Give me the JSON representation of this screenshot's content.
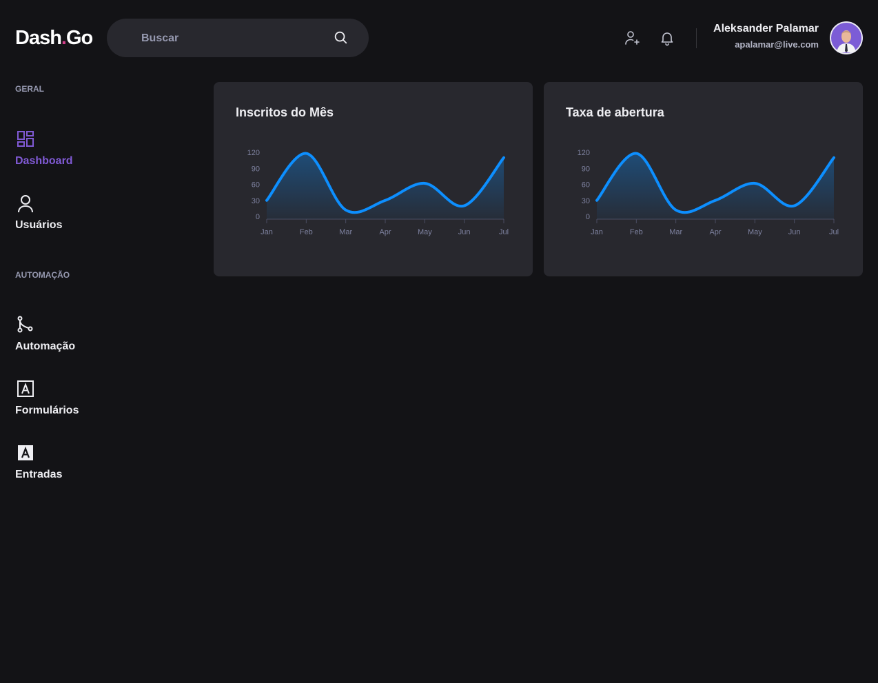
{
  "header": {
    "logo": {
      "text": "Dash",
      "dot": ".",
      "suffix": "Go"
    },
    "search": {
      "placeholder": "Buscar",
      "icon": "search-icon"
    },
    "icons": [
      "user-add-icon",
      "bell-icon"
    ],
    "user": {
      "name": "Aleksander Palamar",
      "email": "apalamar@live.com"
    }
  },
  "sidebar": {
    "sections": [
      {
        "title": "GERAL",
        "items": [
          {
            "label": "Dashboard",
            "icon": "dashboard-icon",
            "active": true
          },
          {
            "label": "Usuários",
            "icon": "user-icon",
            "active": false
          }
        ]
      },
      {
        "title": "AUTOMAÇÃO",
        "items": [
          {
            "label": "Automação",
            "icon": "git-merge-icon",
            "active": false
          },
          {
            "label": "Formulários",
            "icon": "form-icon",
            "active": false
          },
          {
            "label": "Entradas",
            "icon": "input-icon",
            "active": false
          }
        ]
      }
    ]
  },
  "colors": {
    "accent": "#805ad5",
    "logo_dot": "#d53f8c",
    "series": "#0d8fff"
  },
  "chart_data": [
    {
      "type": "area",
      "title": "Inscritos do Mês",
      "categories": [
        "Jan",
        "Feb",
        "Mar",
        "Apr",
        "May",
        "Jun",
        "Jul"
      ],
      "values": [
        30,
        118,
        12,
        30,
        62,
        20,
        110
      ],
      "yticks": [
        0,
        30,
        60,
        90,
        120
      ],
      "ylim": [
        0,
        120
      ],
      "grid": false,
      "smooth": true
    },
    {
      "type": "area",
      "title": "Taxa de abertura",
      "categories": [
        "Jan",
        "Feb",
        "Mar",
        "Apr",
        "May",
        "Jun",
        "Jul"
      ],
      "values": [
        30,
        118,
        12,
        30,
        62,
        20,
        110
      ],
      "yticks": [
        0,
        30,
        60,
        90,
        120
      ],
      "ylim": [
        0,
        120
      ],
      "grid": false,
      "smooth": true
    }
  ]
}
